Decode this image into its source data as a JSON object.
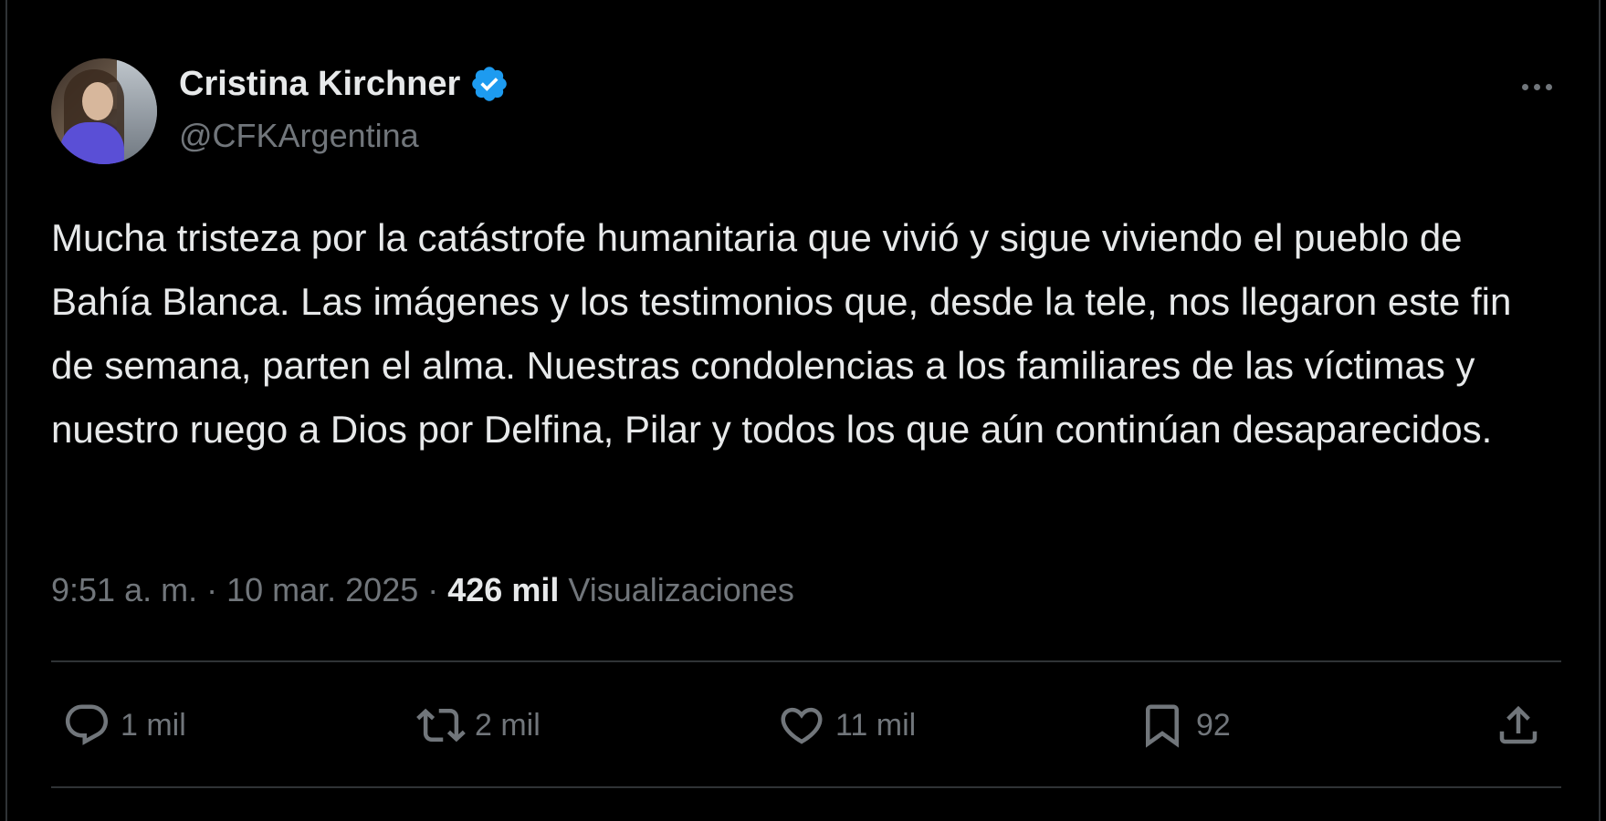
{
  "author": {
    "display_name": "Cristina Kirchner",
    "handle": "@CFKArgentina",
    "verified": true
  },
  "tweet": {
    "text": "Mucha tristeza por la catástrofe humanitaria que vivió y sigue viviendo el pueblo de Bahía Blanca. Las imágenes y los testimonios que, desde la tele, nos llegaron este fin de semana, parten el alma. Nuestras condolencias a los familiares de las víctimas y nuestro ruego a Dios por Delfina, Pilar y todos los que aún continúan desaparecidos."
  },
  "meta": {
    "time": "9:51 a. m.",
    "separator1": " · ",
    "date": "10 mar. 2025",
    "separator2": " · ",
    "views_count": "426 mil",
    "views_label": " Visualizaciones"
  },
  "actions": {
    "reply_count": "1 mil",
    "retweet_count": "2 mil",
    "like_count": "11 mil",
    "bookmark_count": "92"
  },
  "colors": {
    "background": "#000000",
    "text": "#e7e9ea",
    "secondary": "#71767b",
    "verified": "#1d9bf0",
    "divider": "#2f3336"
  }
}
